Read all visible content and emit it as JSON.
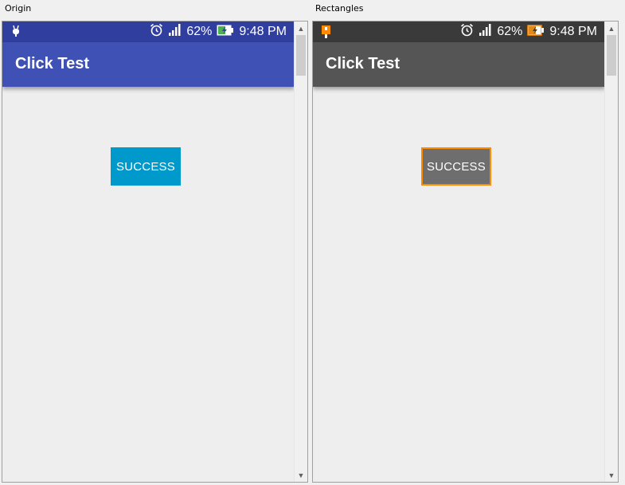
{
  "panels": [
    {
      "label": "Origin",
      "status": {
        "battery": "62%",
        "time": "9:48 PM"
      },
      "app_title": "Click Test",
      "button_label": "SUCCESS",
      "colors": {
        "status_bar": "#303f9f",
        "app_bar": "#3f51b5",
        "button": "#0099cc",
        "button_border": "none"
      }
    },
    {
      "label": "Rectangles",
      "status": {
        "battery": "62%",
        "time": "9:48 PM"
      },
      "app_title": "Click Test",
      "button_label": "SUCCESS",
      "colors": {
        "status_bar": "#3a3a3a",
        "app_bar": "#555555",
        "button": "#6e6e6e",
        "button_border": "#ff8c00"
      }
    }
  ]
}
